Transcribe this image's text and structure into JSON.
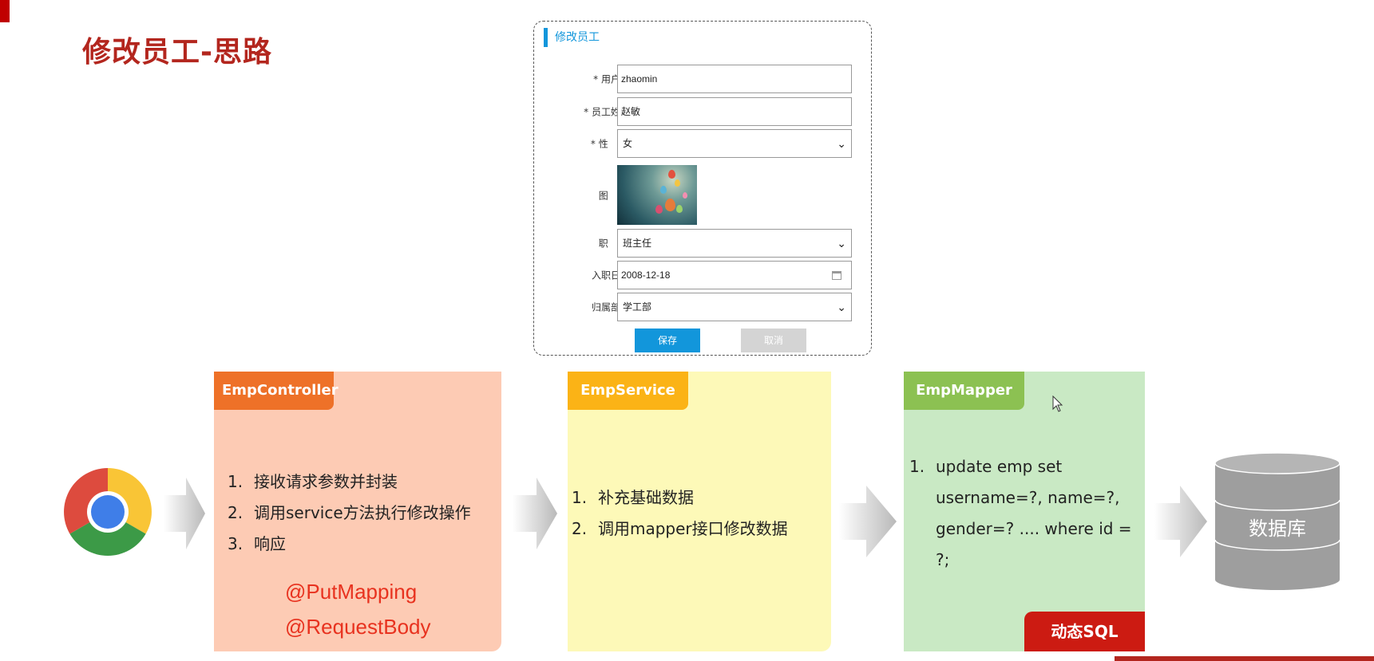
{
  "slide": {
    "title": "修改员工-思路"
  },
  "form": {
    "heading": "修改员工",
    "username_label": "* 用户名",
    "username_value": "zhaomin",
    "name_label": "* 员工姓名",
    "name_value": "赵敏",
    "gender_label": "* 性    别",
    "gender_value": "女",
    "image_label": "图    像",
    "job_label": "职    位",
    "job_value": "班主任",
    "entrydate_label": "入职日期",
    "entrydate_value": "2008-12-18",
    "dept_label": "归属部门",
    "dept_value": "学工部",
    "save_label": "保存",
    "cancel_label": "取消"
  },
  "flow": {
    "controller": {
      "name": "EmpController",
      "steps": [
        {
          "num": "1.",
          "text": "接收请求参数并封装"
        },
        {
          "num": "2.",
          "text": "调用service方法执行修改操作"
        },
        {
          "num": "3.",
          "text": "响应"
        }
      ],
      "annotations": [
        "@PutMapping",
        "@RequestBody"
      ]
    },
    "service": {
      "name": "EmpService",
      "steps": [
        {
          "num": "1.",
          "text": "补充基础数据"
        },
        {
          "num": "2.",
          "text": "调用mapper接口修改数据"
        }
      ]
    },
    "mapper": {
      "name": "EmpMapper",
      "steps": [
        {
          "num": "1.",
          "text": "update emp set username=?, name=?, gender=? .... where id = ?;"
        }
      ],
      "badge": "动态SQL"
    },
    "database": {
      "label": "数据库"
    }
  },
  "icons": {
    "browser": "chrome-icon",
    "flow_arrow": "arrow-right-icon",
    "database": "database-cylinder-icon",
    "calendar": "calendar-icon",
    "select": "chevron-down-icon",
    "cursor": "mouse-pointer-icon"
  },
  "colors": {
    "title": "#b3261e",
    "controller_tab": "#ee7128",
    "controller_body": "#fdcbb4",
    "service_tab": "#fbb316",
    "service_body": "#fdf9b8",
    "mapper_tab": "#8cc152",
    "mapper_body": "#c9e9c4",
    "badge": "#cc1b12",
    "form_accent": "#1296db",
    "annotation": "#e8321f"
  }
}
